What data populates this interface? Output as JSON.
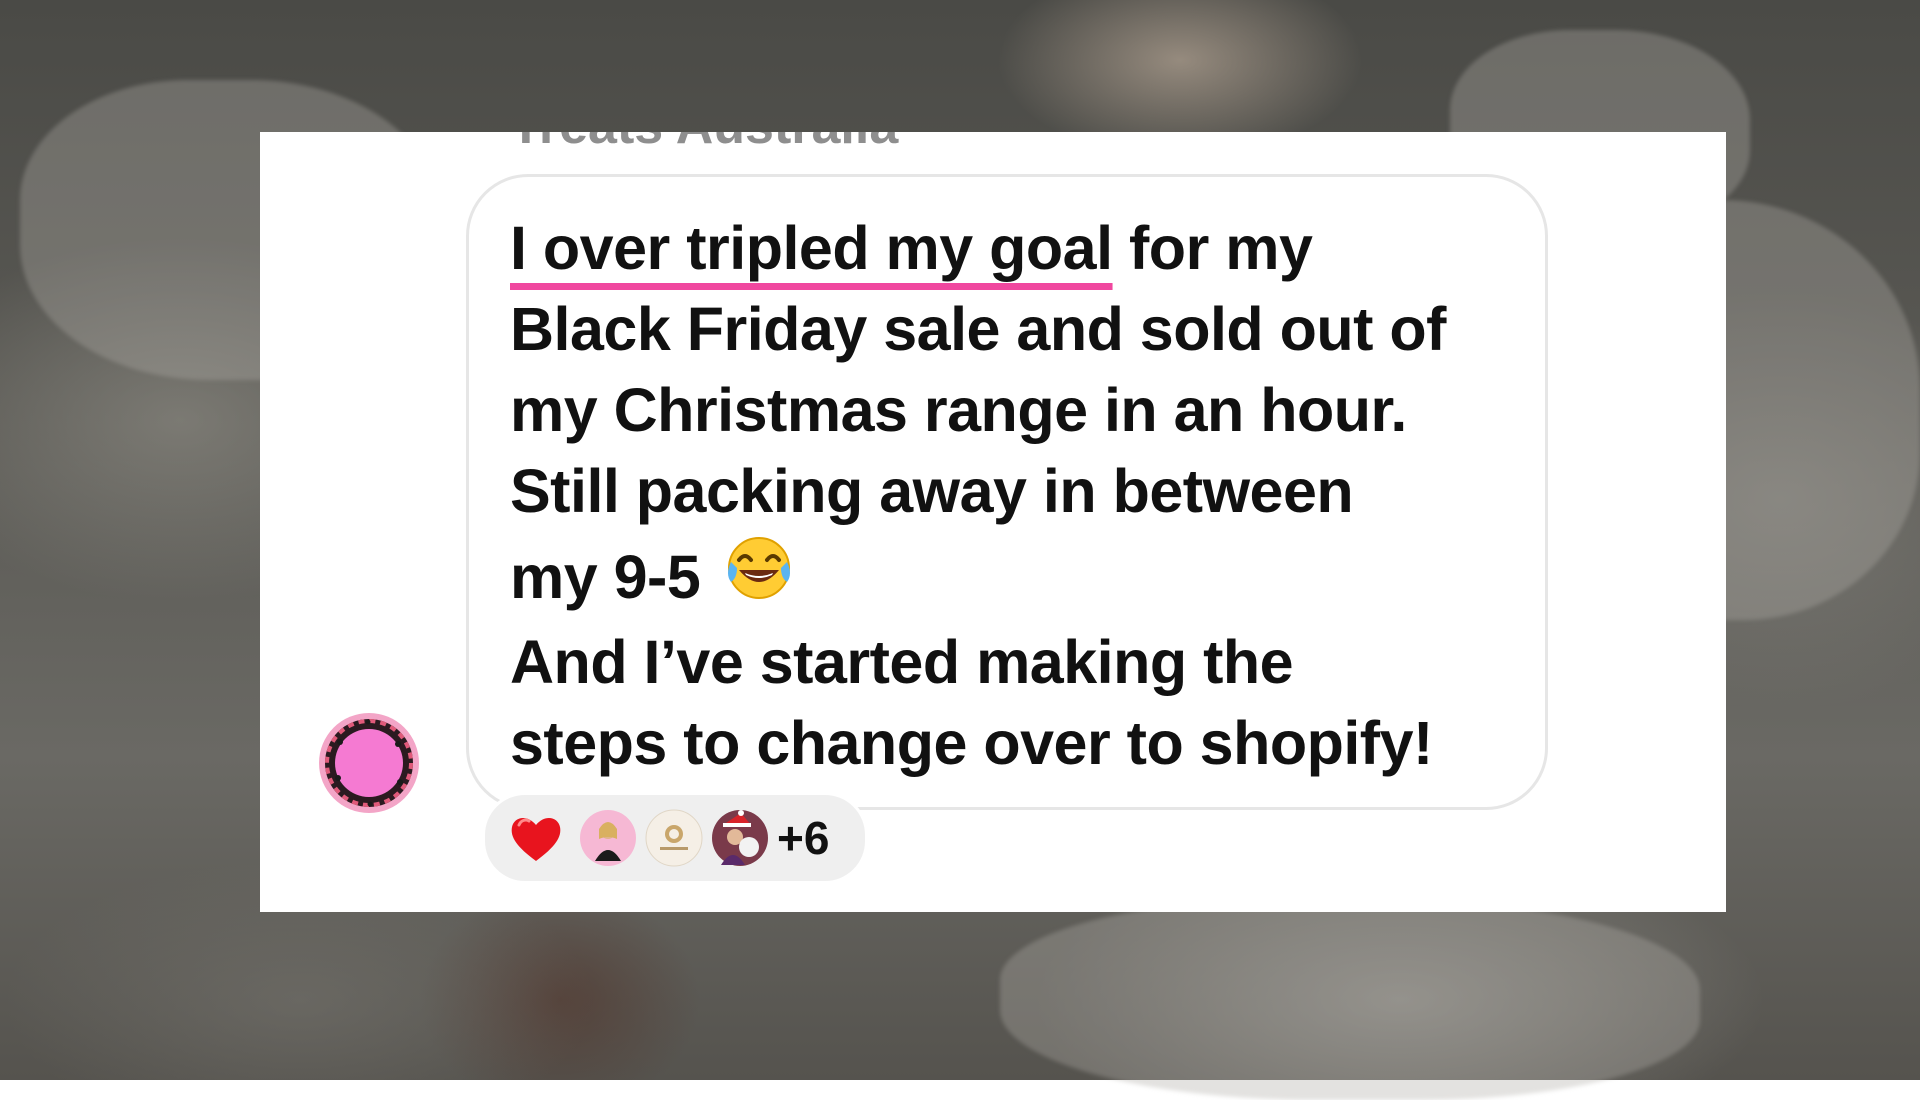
{
  "header": {
    "partial_name": "Treats Australia"
  },
  "message": {
    "highlight": "I over tripled my goal",
    "line1_rest": " for my",
    "line2": "Black Friday sale and sold out of",
    "line3": "my Christmas range in an hour.",
    "line4": "Still packing away in between",
    "line5": "my 9-5",
    "emoji": "face-with-tears-of-joy",
    "line6": "And I’ve started making the",
    "line7": "steps to change over to shopify!"
  },
  "colors": {
    "highlight_underline": "#f0479f",
    "bubble_border": "#e6e6e6",
    "reaction_bar": "#efefef",
    "avatar_pink": "#f57ad2"
  },
  "reactions": {
    "items": [
      "red-heart-icon",
      "reactor-avatar-1",
      "reactor-avatar-2",
      "reactor-avatar-3"
    ],
    "extra_count": "+6"
  }
}
